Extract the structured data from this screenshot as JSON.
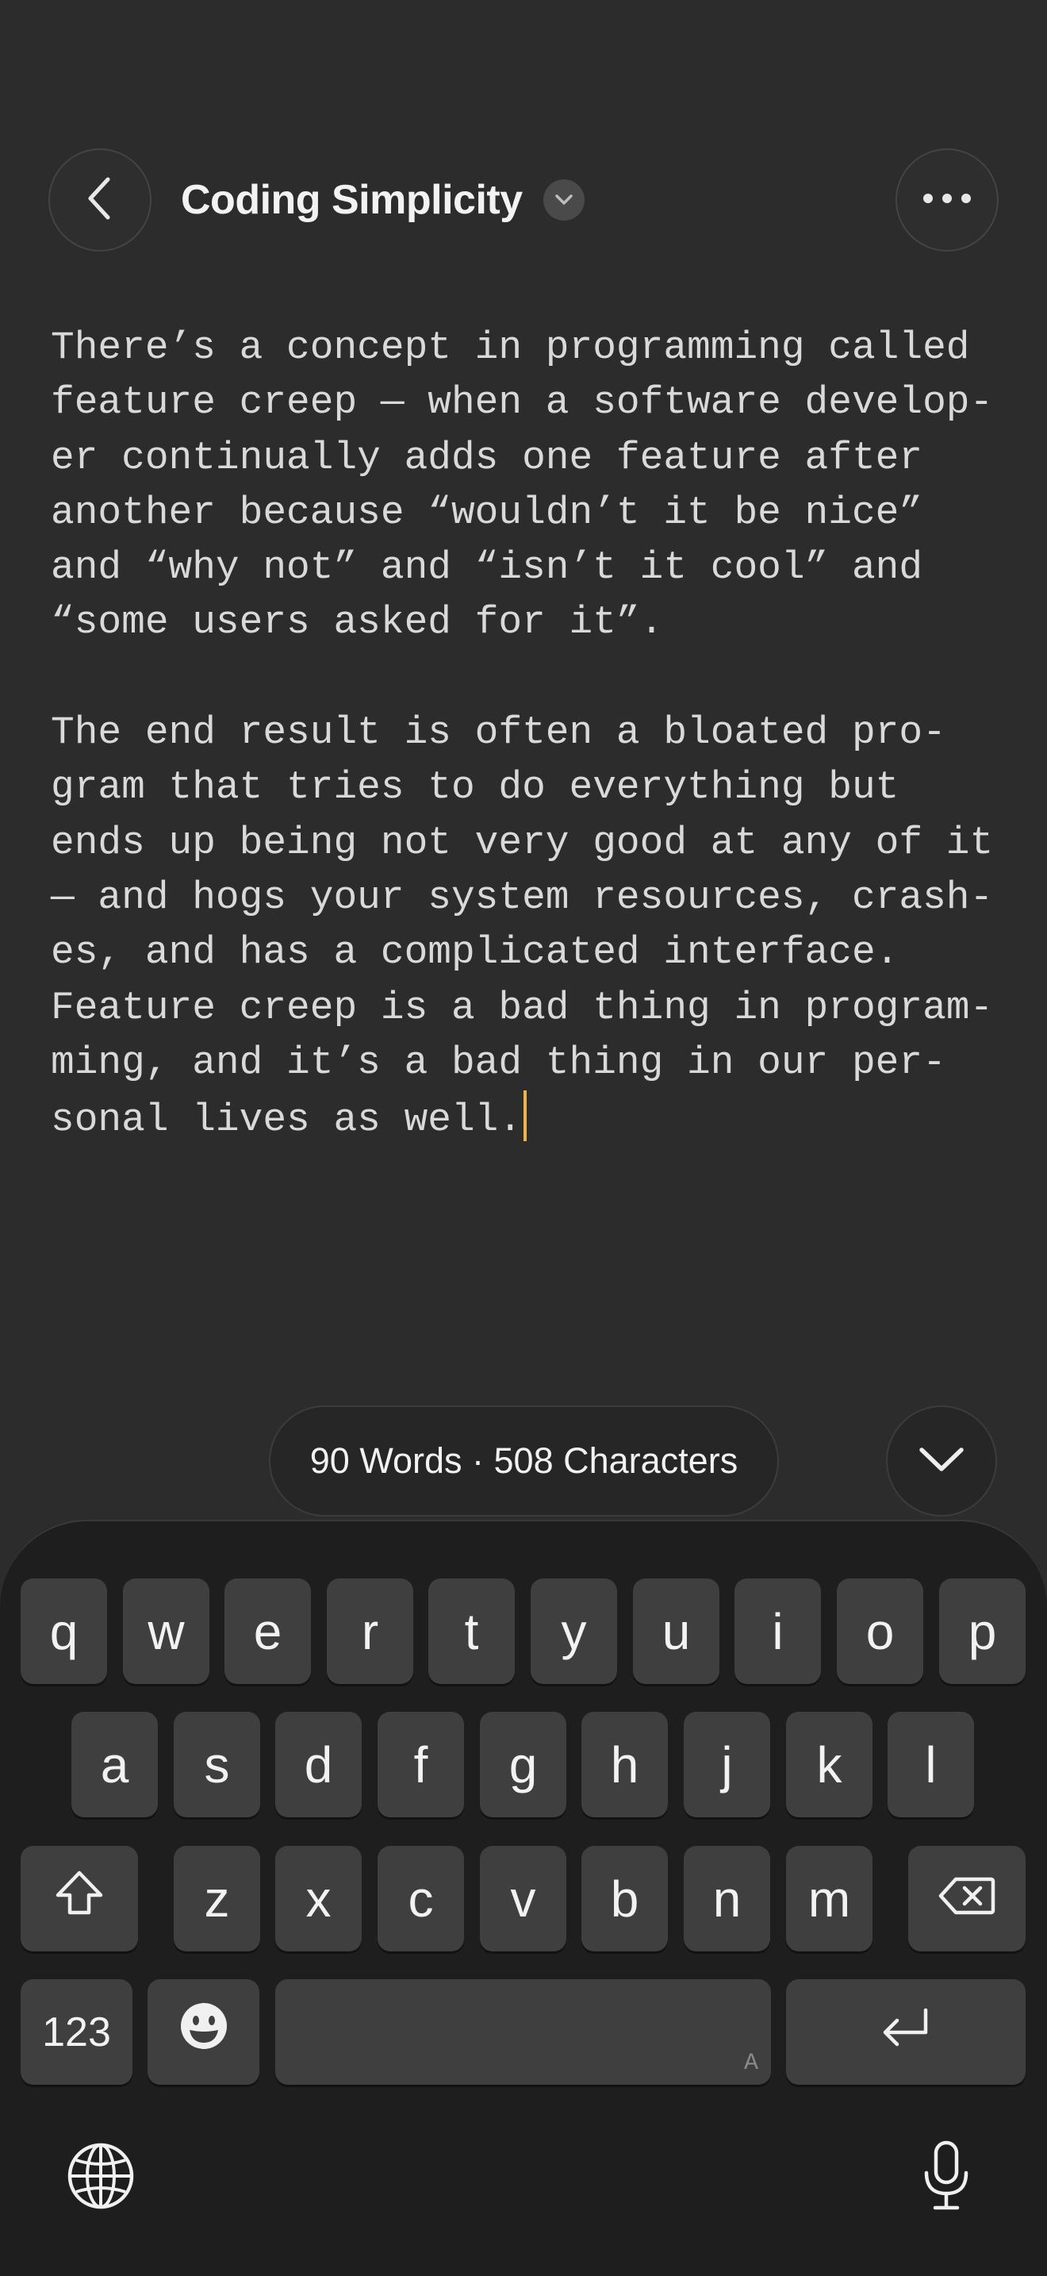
{
  "header": {
    "title": "Coding Simplicity",
    "back_icon": "chevron-left-icon",
    "title_menu_icon": "chevron-down-icon",
    "more_icon": "ellipsis-icon"
  },
  "editor": {
    "paragraphs": [
      {
        "lines": [
          "There’s a concept in programming called",
          "feature creep — when a software develop-",
          "er continually adds one feature after",
          "another because “wouldn’t it be nice”",
          "and “why not” and “isn’t it cool” and",
          "“some users asked for it”."
        ]
      },
      {
        "lines": [
          "The end result is often a bloated pro-",
          "gram that tries to do everything but",
          "ends up being not very good at any of it",
          "— and hogs your system resources, crash-",
          "es, and has a complicated interface.",
          "Feature creep is a bad thing in program-",
          "ming, and it’s a bad thing in our per-",
          "sonal lives as well."
        ]
      }
    ],
    "caret_color": "#f0b445"
  },
  "stats": {
    "text": "90 Words · 508 Characters"
  },
  "dismiss_icon": "chevron-down-icon",
  "keyboard": {
    "row1": [
      "q",
      "w",
      "e",
      "r",
      "t",
      "y",
      "u",
      "i",
      "o",
      "p"
    ],
    "row2": [
      "a",
      "s",
      "d",
      "f",
      "g",
      "h",
      "j",
      "k",
      "l"
    ],
    "row3": [
      "z",
      "x",
      "c",
      "v",
      "b",
      "n",
      "m"
    ],
    "numbers_label": "123",
    "space_hint": "A",
    "shift_icon": "shift-icon",
    "delete_icon": "backspace-icon",
    "emoji_icon": "emoji-icon",
    "return_icon": "return-icon",
    "globe_icon": "globe-icon",
    "mic_icon": "microphone-icon"
  }
}
